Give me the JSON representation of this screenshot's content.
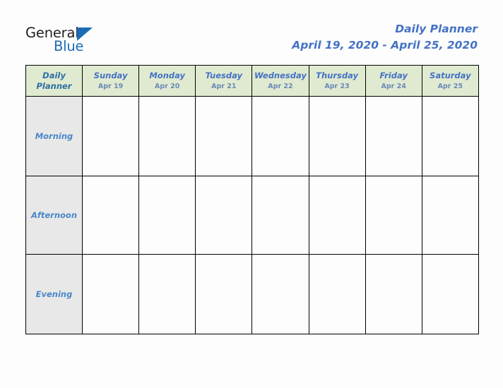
{
  "brand": {
    "name_part1": "General",
    "name_part2": "Blue",
    "triangle_icon": "triangle-icon",
    "colors": {
      "dark": "#231f20",
      "blue": "#1b6cb5"
    }
  },
  "header": {
    "title": "Daily Planner",
    "date_range": "April 19, 2020 - April 25, 2020",
    "title_color": "#4472c4"
  },
  "table": {
    "corner_label_line1": "Daily",
    "corner_label_line2": "Planner",
    "header_bg": "#e0ead0",
    "label_bg": "#e8e8e8",
    "cell_bg": "#fdfdfd",
    "border_color": "#000000",
    "columns": [
      {
        "day": "Sunday",
        "date": "Apr 19"
      },
      {
        "day": "Monday",
        "date": "Apr 20"
      },
      {
        "day": "Tuesday",
        "date": "Apr 21"
      },
      {
        "day": "Wednesday",
        "date": "Apr 22"
      },
      {
        "day": "Thursday",
        "date": "Apr 23"
      },
      {
        "day": "Friday",
        "date": "Apr 24"
      },
      {
        "day": "Saturday",
        "date": "Apr 25"
      }
    ],
    "rows": [
      {
        "label": "Morning",
        "cells": [
          "",
          "",
          "",
          "",
          "",
          "",
          ""
        ]
      },
      {
        "label": "Afternoon",
        "cells": [
          "",
          "",
          "",
          "",
          "",
          "",
          ""
        ]
      },
      {
        "label": "Evening",
        "cells": [
          "",
          "",
          "",
          "",
          "",
          "",
          ""
        ]
      }
    ]
  }
}
